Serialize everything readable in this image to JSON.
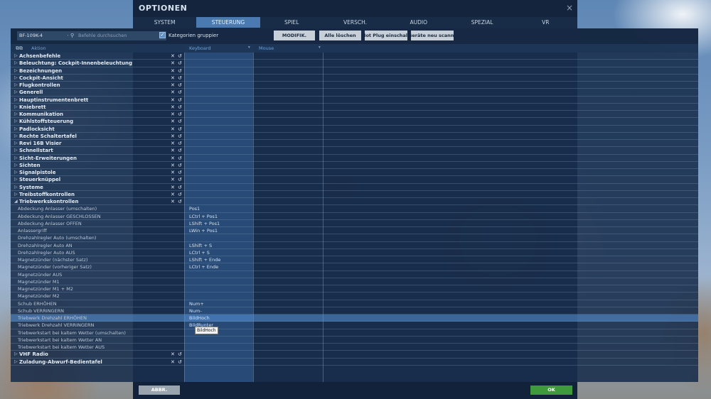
{
  "window": {
    "title": "OPTIONEN",
    "close": "×"
  },
  "tabs": [
    {
      "label": "SYSTEM"
    },
    {
      "label": "STEUERUNG",
      "active": true
    },
    {
      "label": "SPIEL"
    },
    {
      "label": "VERSCH."
    },
    {
      "label": "AUDIO"
    },
    {
      "label": "SPEZIAL"
    },
    {
      "label": "VR"
    }
  ],
  "toolbar": {
    "aircraft": "BF-109K-4",
    "search_placeholder": "Befehle durchsuchen",
    "group_checked": true,
    "group_label": "Kategorien gruppier",
    "btn_modifiers": "MODIFIK.",
    "btn_clear_all": "Alle löschen",
    "btn_hotplug": "Hot Plug einschalten",
    "btn_rescan": "Geräte neu scannen"
  },
  "columns": {
    "action": "Aktion",
    "keyboard": "Keyboard",
    "mouse": "Mouse"
  },
  "rows": [
    {
      "label": "Achsenbefehle",
      "cat": true,
      "kb": ""
    },
    {
      "label": "Beleuchtung: Cockpit-Innenbeleuchtung",
      "cat": true,
      "kb": ""
    },
    {
      "label": "Bezeichnungen",
      "cat": true,
      "kb": ""
    },
    {
      "label": "Cockpit-Ansicht",
      "cat": true,
      "kb": ""
    },
    {
      "label": "Flugkontrollen",
      "cat": true,
      "kb": ""
    },
    {
      "label": "Generell",
      "cat": true,
      "kb": ""
    },
    {
      "label": "Hauptinstrumentenbrett",
      "cat": true,
      "kb": ""
    },
    {
      "label": "Kniebrett",
      "cat": true,
      "kb": ""
    },
    {
      "label": "Kommunikation",
      "cat": true,
      "kb": ""
    },
    {
      "label": "Kühlstoffsteuerung",
      "cat": true,
      "kb": ""
    },
    {
      "label": "Padlocksicht",
      "cat": true,
      "kb": ""
    },
    {
      "label": "Rechte Schaltertafel",
      "cat": true,
      "kb": ""
    },
    {
      "label": "Revi 16B Visier",
      "cat": true,
      "kb": ""
    },
    {
      "label": "Schnellstart",
      "cat": true,
      "kb": ""
    },
    {
      "label": "Sicht-Erweiterungen",
      "cat": true,
      "kb": ""
    },
    {
      "label": "Sichten",
      "cat": true,
      "kb": ""
    },
    {
      "label": "Signalpistole",
      "cat": true,
      "kb": ""
    },
    {
      "label": "Steuerknüppel",
      "cat": true,
      "kb": ""
    },
    {
      "label": "Systeme",
      "cat": true,
      "kb": ""
    },
    {
      "label": "Treibstoffkontrollen",
      "cat": true,
      "kb": ""
    },
    {
      "label": "Triebwerkskontrollen",
      "cat": true,
      "expanded": true,
      "kb": ""
    },
    {
      "label": "Abdeckung Anlasser (umschalten)",
      "kb": "Pos1"
    },
    {
      "label": "Abdeckung Anlasser GESCHLOSSEN",
      "kb": "LCtrl + Pos1"
    },
    {
      "label": "Abdeckung Anlasser OFFEN",
      "kb": "LShift + Pos1"
    },
    {
      "label": "Anlassergriff",
      "kb": "LWin + Pos1"
    },
    {
      "label": "Drehzahlregler Auto (umschalten)",
      "kb": ""
    },
    {
      "label": "Drehzahlregler Auto AN",
      "kb": "LShift + S"
    },
    {
      "label": "Drehzahlregler Auto AUS",
      "kb": "LCtrl + S"
    },
    {
      "label": "Magnetzünder (nächster Satz)",
      "kb": "LShift + Ende"
    },
    {
      "label": "Magnetzünder (vorheriger Satz)",
      "kb": "LCtrl + Ende"
    },
    {
      "label": "Magnetzünder AUS",
      "kb": ""
    },
    {
      "label": "Magnetzünder M1",
      "kb": ""
    },
    {
      "label": "Magnetzünder M1 + M2",
      "kb": ""
    },
    {
      "label": "Magnetzünder M2",
      "kb": ""
    },
    {
      "label": "Schub ERHÖHEN",
      "kb": "Num+"
    },
    {
      "label": "Schub VERRINGERN",
      "kb": "Num-"
    },
    {
      "label": "Triebwerk Drehzahl ERHÖHEN",
      "kb": "BildHoch",
      "selected": true
    },
    {
      "label": "Triebwerk Drehzahl VERRINGERN",
      "kb": "BildRunter"
    },
    {
      "label": "Triebwerkstart bei kaltem Wetter (umschalten)",
      "kb": ""
    },
    {
      "label": "Triebwerkstart bei kaltem Wetter AN",
      "kb": ""
    },
    {
      "label": "Triebwerkstart bei kaltem Wetter AUS",
      "kb": ""
    },
    {
      "label": "VHF Radio",
      "cat": true,
      "kb": ""
    },
    {
      "label": "Zuladung-Abwurf-Bedientafel",
      "cat": true,
      "kb": ""
    }
  ],
  "tooltip": "BildHoch",
  "footer": {
    "cancel": "ABBR.",
    "ok": "OK"
  }
}
